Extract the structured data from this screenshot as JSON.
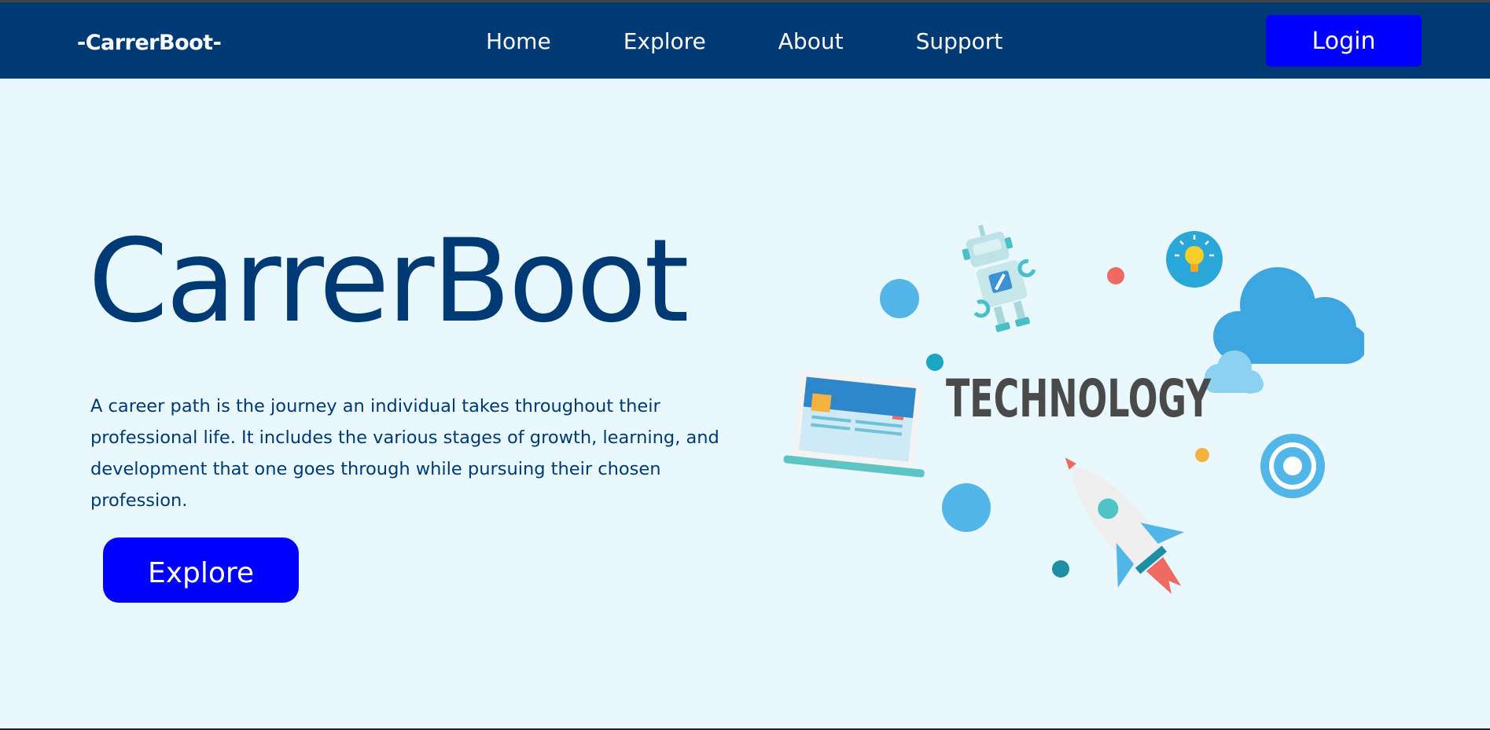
{
  "nav": {
    "brand": "-CarrerBoot-",
    "links": [
      "Home",
      "Explore",
      "About",
      "Support"
    ],
    "login_label": "Login"
  },
  "hero": {
    "title": "CarrerBoot",
    "description": "A career path is the journey an individual takes throughout their professional life. It includes the various stages of growth, learning, and development that one goes through while pursuing their chosen profession.",
    "explore_label": "Explore"
  },
  "illustration": {
    "word": "TECHNOLOGY",
    "icons": [
      "robot-icon",
      "lightbulb-icon",
      "cloud-icon",
      "laptop-icon",
      "gear-icon",
      "rocket-icon"
    ]
  },
  "colors": {
    "navbar": "#003a75",
    "background": "#e8f8fd",
    "button": "#0000ff",
    "title": "#003a75"
  }
}
